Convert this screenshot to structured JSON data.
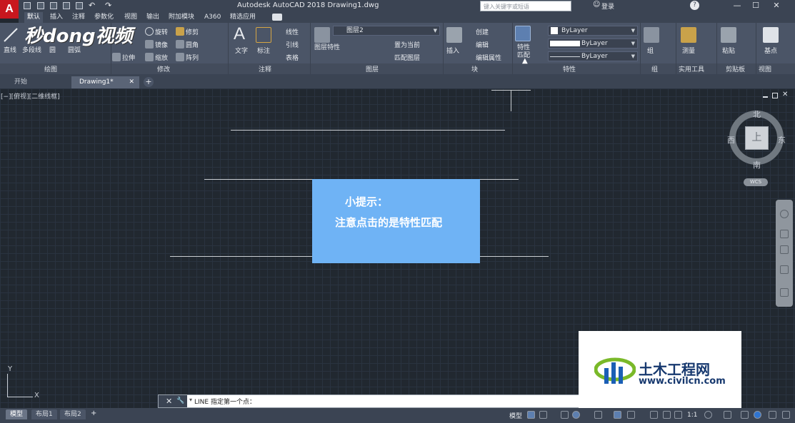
{
  "app": {
    "logo": "A",
    "title": "Autodesk AutoCAD 2018    Drawing1.dwg",
    "search_placeholder": "键入关键字或短语",
    "login": "登录",
    "window_buttons": [
      "—",
      "☐",
      "✕"
    ]
  },
  "ribbon_tabs": [
    "默认",
    "插入",
    "注释",
    "参数化",
    "视图",
    "输出",
    "附加模块",
    "A360",
    "精选应用"
  ],
  "ribbon": {
    "draw": {
      "line": "直线",
      "polyline": "多段线",
      "circle": "圆",
      "arc": "圆弧",
      "label": "绘图"
    },
    "modify": {
      "items": [
        "旋转",
        "修剪",
        "镜像",
        "圆角",
        "拉伸",
        "缩放",
        "阵列"
      ],
      "label": "修改"
    },
    "annotation": {
      "text": "文字",
      "dimension": "标注",
      "linear": "线性",
      "leader": "引线",
      "table": "表格",
      "label": "注释"
    },
    "layers": {
      "layer_properties": "图层特性",
      "layer_combo": "图层2",
      "set_current": "置为当前",
      "match_layer": "匹配图层",
      "label": "图层"
    },
    "block": {
      "insert": "插入",
      "create": "创建",
      "edit": "编辑",
      "edit_attributes": "编辑属性",
      "label": "块"
    },
    "properties": {
      "match_properties": "特性匹配",
      "color": "ByLayer",
      "linetype": "ByLayer",
      "lineweight": "ByLayer",
      "label": "特性"
    },
    "groups": {
      "group": "组",
      "label": "组"
    },
    "utilities": {
      "measure": "测量",
      "label": "实用工具"
    },
    "clipboard": {
      "paste": "粘贴",
      "label": "剪贴板"
    },
    "view": {
      "base": "基点",
      "label": "视图"
    }
  },
  "file_tabs": [
    "开始",
    "Drawing1*"
  ],
  "viewport": {
    "label": "[−][俯视][二维线框]",
    "compass": {
      "north": "北",
      "south": "南",
      "east": "东",
      "west": "西"
    },
    "cube_face": "上",
    "wcs": "WCS",
    "ucs_x": "X",
    "ucs_y": "Y"
  },
  "tip": {
    "title": "小提示：",
    "body": "注意点击的是特性匹配"
  },
  "command_line": {
    "text": "LINE 指定第一个点："
  },
  "layout_tabs": [
    "模型",
    "布局1",
    "布局2"
  ],
  "status": {
    "model": "模型",
    "scale": "1:1"
  },
  "watermarks": {
    "video_logo": "秒dong视频",
    "site_title": "土木工程网",
    "site_url": "www.civilcn.com"
  }
}
